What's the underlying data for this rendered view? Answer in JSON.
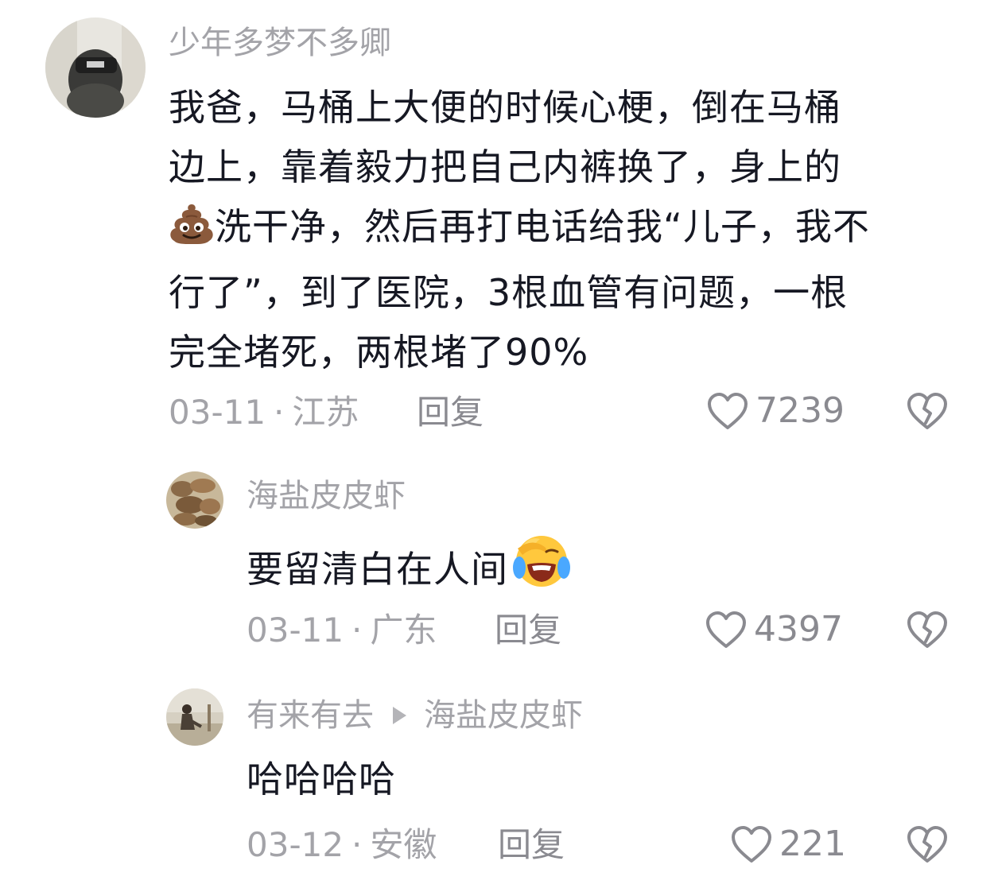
{
  "comments": [
    {
      "username": "少年多梦不多卿",
      "text_lines": [
        "我爸，马桶上大便的时候心梗，倒在马桶",
        "边上，靠着毅力把自己内裤换了，身上的",
        "洗干净，然后再打电话给我“儿子，我不",
        "行了”，到了医院，3根血管有问题，一根",
        "完全堵死，两根堵了90%"
      ],
      "inline_emoji": "poop-emoji",
      "date": "03-11",
      "location": "江苏",
      "reply_label": "回复",
      "likes": "7239"
    },
    {
      "username": "海盐皮皮虾",
      "text": "要留清白在人间",
      "inline_emoji": "laughing-crying-emoji",
      "date": "03-11",
      "location": "广东",
      "reply_label": "回复",
      "likes": "4397"
    },
    {
      "username": "有来有去",
      "reply_to": "海盐皮皮虾",
      "text": "哈哈哈哈",
      "date": "03-12",
      "location": "安徽",
      "reply_label": "回复",
      "likes": "221"
    }
  ],
  "meta_separator": "·",
  "icons": {
    "like": "heart-outline-icon",
    "dislike": "broken-heart-icon",
    "reply_indicator": "triangle-right-icon"
  },
  "colors": {
    "text_primary": "#161823",
    "text_secondary": "#a3a3a8",
    "icon": "#8a8a90"
  }
}
